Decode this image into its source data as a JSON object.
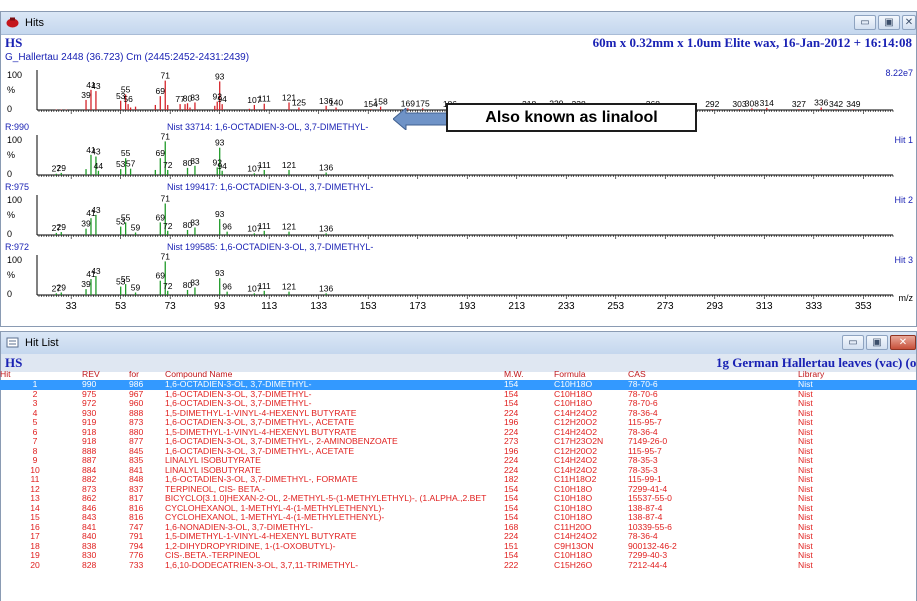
{
  "hits_window": {
    "title": "Hits",
    "header_left": "HS",
    "header_right": "60m x 0.32mm x 1.0um Elite wax,  16-Jan-2012 + 16:14:08",
    "sample_label": "G_Hallertau 2448 (36.723) Cm (2445:2452-2431:2439)",
    "intensity": "8.22e7",
    "x_axis_unit": "m/z",
    "x_ticks": [
      "33",
      "53",
      "73",
      "93",
      "113",
      "133",
      "153",
      "173",
      "193",
      "213",
      "233",
      "253",
      "273",
      "293",
      "313",
      "333",
      "353"
    ],
    "panels": [
      {
        "left_label": "",
        "match": "",
        "hit_label": "",
        "color": "#d4242b",
        "peaks": [
          [
            27,
            1
          ],
          [
            29,
            1
          ],
          [
            31,
            1
          ],
          [
            39,
            24
          ],
          [
            41,
            48
          ],
          [
            43,
            45
          ],
          [
            53,
            22
          ],
          [
            55,
            37
          ],
          [
            56,
            14
          ],
          [
            57,
            6
          ],
          [
            59,
            8
          ],
          [
            67,
            12
          ],
          [
            69,
            33
          ],
          [
            71,
            70
          ],
          [
            72,
            12
          ],
          [
            77,
            14
          ],
          [
            79,
            14
          ],
          [
            80,
            16
          ],
          [
            81,
            6
          ],
          [
            83,
            18
          ],
          [
            91,
            10
          ],
          [
            92,
            20
          ],
          [
            93,
            68
          ],
          [
            94,
            14
          ],
          [
            105,
            3
          ],
          [
            107,
            12
          ],
          [
            111,
            15
          ],
          [
            121,
            18
          ],
          [
            125,
            6
          ],
          [
            136,
            10
          ],
          [
            140,
            6
          ],
          [
            154,
            2
          ],
          [
            158,
            8
          ],
          [
            169,
            4
          ],
          [
            175,
            4
          ],
          [
            186,
            2
          ],
          [
            218,
            2
          ],
          [
            229,
            3
          ],
          [
            238,
            2
          ],
          [
            268,
            2
          ],
          [
            292,
            2
          ],
          [
            303,
            2
          ],
          [
            308,
            4
          ],
          [
            314,
            5
          ],
          [
            327,
            2
          ],
          [
            336,
            6
          ],
          [
            342,
            2
          ],
          [
            349,
            2
          ]
        ],
        "labels": [
          [
            "39",
            "39"
          ],
          [
            "41",
            "41"
          ],
          [
            "43",
            "43"
          ],
          [
            "53",
            "53"
          ],
          [
            "55",
            "55"
          ],
          [
            "56",
            "56"
          ],
          [
            "69",
            "69"
          ],
          [
            "71",
            "71"
          ],
          [
            "77",
            "77"
          ],
          [
            "80",
            "80"
          ],
          [
            "83",
            "83"
          ],
          [
            "92",
            "92"
          ],
          [
            "93",
            "93"
          ],
          [
            "94",
            "94"
          ],
          [
            "107",
            "107"
          ],
          [
            "111",
            "111"
          ],
          [
            "121",
            "121"
          ],
          [
            "125",
            "125"
          ],
          [
            "136",
            "136"
          ],
          [
            "140",
            "140"
          ],
          [
            "154",
            "154"
          ],
          [
            "158",
            "158"
          ],
          [
            "169",
            "169"
          ],
          [
            "175",
            "175"
          ],
          [
            "186",
            "186"
          ],
          [
            "218",
            "218"
          ],
          [
            "229",
            "229"
          ],
          [
            "238",
            "238"
          ],
          [
            "268",
            "268"
          ],
          [
            "292",
            "292"
          ],
          [
            "303",
            "303"
          ],
          [
            "308",
            "308"
          ],
          [
            "314",
            "314"
          ],
          [
            "327",
            "327"
          ],
          [
            "336",
            "336"
          ],
          [
            "342",
            "342"
          ],
          [
            "349",
            "349"
          ]
        ]
      },
      {
        "left_label": "R:990",
        "match": "Nist  33714: 1,6-OCTADIEN-3-OL, 3,7-DIMETHYL-",
        "hit_label": "Hit 1",
        "color": "#1f9a28",
        "peaks": [
          [
            27,
            3
          ],
          [
            29,
            5
          ],
          [
            39,
            14
          ],
          [
            41,
            48
          ],
          [
            43,
            44
          ],
          [
            44,
            10
          ],
          [
            53,
            14
          ],
          [
            55,
            40
          ],
          [
            57,
            15
          ],
          [
            67,
            12
          ],
          [
            69,
            40
          ],
          [
            71,
            80
          ],
          [
            72,
            12
          ],
          [
            80,
            17
          ],
          [
            83,
            22
          ],
          [
            92,
            18
          ],
          [
            93,
            65
          ],
          [
            94,
            10
          ],
          [
            107,
            4
          ],
          [
            111,
            12
          ],
          [
            121,
            12
          ],
          [
            136,
            6
          ]
        ],
        "labels": [
          [
            "27",
            "27"
          ],
          [
            "29",
            "29"
          ],
          [
            "41",
            "41"
          ],
          [
            "43",
            "43"
          ],
          [
            "44",
            "44"
          ],
          [
            "53",
            "53"
          ],
          [
            "55",
            "55"
          ],
          [
            "57",
            "57"
          ],
          [
            "69",
            "69"
          ],
          [
            "71",
            "71"
          ],
          [
            "72",
            "72"
          ],
          [
            "80",
            "80"
          ],
          [
            "83",
            "83"
          ],
          [
            "92",
            "92"
          ],
          [
            "93",
            "93"
          ],
          [
            "94",
            "94"
          ],
          [
            "107",
            "107"
          ],
          [
            "111",
            "111"
          ],
          [
            "121",
            "121"
          ],
          [
            "136",
            "136"
          ]
        ]
      },
      {
        "left_label": "R:975",
        "match": "Nist  199417: 1,6-OCTADIEN-3-OL, 3,7-DIMETHYL-",
        "hit_label": "Hit 2",
        "color": "#1f9a28",
        "peaks": [
          [
            27,
            5
          ],
          [
            29,
            7
          ],
          [
            39,
            15
          ],
          [
            41,
            40
          ],
          [
            43,
            48
          ],
          [
            53,
            20
          ],
          [
            55,
            30
          ],
          [
            59,
            6
          ],
          [
            69,
            30
          ],
          [
            71,
            75
          ],
          [
            72,
            10
          ],
          [
            80,
            12
          ],
          [
            83,
            18
          ],
          [
            93,
            38
          ],
          [
            96,
            8
          ],
          [
            107,
            4
          ],
          [
            111,
            10
          ],
          [
            121,
            8
          ],
          [
            136,
            4
          ]
        ],
        "labels": [
          [
            "27",
            "27"
          ],
          [
            "29",
            "29"
          ],
          [
            "39",
            "39"
          ],
          [
            "41",
            "41"
          ],
          [
            "43",
            "43"
          ],
          [
            "53",
            "53"
          ],
          [
            "55",
            "55"
          ],
          [
            "59",
            "59"
          ],
          [
            "69",
            "69"
          ],
          [
            "71",
            "71"
          ],
          [
            "72",
            "72"
          ],
          [
            "80",
            "80"
          ],
          [
            "83",
            "83"
          ],
          [
            "93",
            "93"
          ],
          [
            "96",
            "96"
          ],
          [
            "107",
            "107"
          ],
          [
            "111",
            "111"
          ],
          [
            "121",
            "121"
          ],
          [
            "136",
            "136"
          ]
        ]
      },
      {
        "left_label": "R:972",
        "match": "Nist  199585: 1,6-OCTADIEN-3-OL, 3,7-DIMETHYL-",
        "hit_label": "Hit 3",
        "color": "#1f9a28",
        "peaks": [
          [
            27,
            4
          ],
          [
            29,
            6
          ],
          [
            39,
            14
          ],
          [
            41,
            38
          ],
          [
            43,
            45
          ],
          [
            53,
            20
          ],
          [
            55,
            26
          ],
          [
            59,
            6
          ],
          [
            69,
            34
          ],
          [
            71,
            80
          ],
          [
            72,
            10
          ],
          [
            80,
            12
          ],
          [
            83,
            18
          ],
          [
            93,
            40
          ],
          [
            96,
            8
          ],
          [
            107,
            4
          ],
          [
            111,
            10
          ],
          [
            121,
            8
          ],
          [
            136,
            4
          ]
        ],
        "labels": [
          [
            "27",
            "27"
          ],
          [
            "29",
            "29"
          ],
          [
            "39",
            "39"
          ],
          [
            "41",
            "41"
          ],
          [
            "43",
            "43"
          ],
          [
            "53",
            "53"
          ],
          [
            "55",
            "55"
          ],
          [
            "59",
            "59"
          ],
          [
            "69",
            "69"
          ],
          [
            "71",
            "71"
          ],
          [
            "72",
            "72"
          ],
          [
            "80",
            "80"
          ],
          [
            "83",
            "83"
          ],
          [
            "93",
            "93"
          ],
          [
            "96",
            "96"
          ],
          [
            "107",
            "107"
          ],
          [
            "111",
            "111"
          ],
          [
            "121",
            "121"
          ],
          [
            "136",
            "136"
          ]
        ]
      }
    ],
    "axis": {
      "y_ticks": [
        "100",
        "%",
        "0"
      ],
      "mz_min": 20,
      "mz_max": 365
    }
  },
  "callout": {
    "text": "Also known as linalool"
  },
  "hitlist_window": {
    "title": "Hit List",
    "header_left": "HS",
    "header_right": "1g German Hallertau leaves (vac) (ol",
    "columns": [
      "Hit",
      "REV",
      "for",
      "Compound Name",
      "M.W.",
      "Formula",
      "CAS",
      "Library"
    ],
    "rows": [
      [
        "1",
        "990",
        "986",
        "1,6-OCTADIEN-3-OL, 3,7-DIMETHYL-",
        "154",
        "C10H18O",
        "78-70-6",
        "Nist"
      ],
      [
        "2",
        "975",
        "967",
        "1,6-OCTADIEN-3-OL, 3,7-DIMETHYL-",
        "154",
        "C10H18O",
        "78-70-6",
        "Nist"
      ],
      [
        "3",
        "972",
        "960",
        "1,6-OCTADIEN-3-OL, 3,7-DIMETHYL-",
        "154",
        "C10H18O",
        "78-70-6",
        "Nist"
      ],
      [
        "4",
        "930",
        "888",
        "1,5-DIMETHYL-1-VINYL-4-HEXENYL BUTYRATE",
        "224",
        "C14H24O2",
        "78-36-4",
        "Nist"
      ],
      [
        "5",
        "919",
        "873",
        "1,6-OCTADIEN-3-OL, 3,7-DIMETHYL-, ACETATE",
        "196",
        "C12H20O2",
        "115-95-7",
        "Nist"
      ],
      [
        "6",
        "918",
        "880",
        "1,5-DIMETHYL-1-VINYL-4-HEXENYL BUTYRATE",
        "224",
        "C14H24O2",
        "78-36-4",
        "Nist"
      ],
      [
        "7",
        "918",
        "877",
        "1,6-OCTADIEN-3-OL, 3,7-DIMETHYL-, 2-AMINOBENZOATE",
        "273",
        "C17H23O2N",
        "7149-26-0",
        "Nist"
      ],
      [
        "8",
        "888",
        "845",
        "1,6-OCTADIEN-3-OL, 3,7-DIMETHYL-, ACETATE",
        "196",
        "C12H20O2",
        "115-95-7",
        "Nist"
      ],
      [
        "9",
        "887",
        "835",
        "LINALYL ISOBUTYRATE",
        "224",
        "C14H24O2",
        "78-35-3",
        "Nist"
      ],
      [
        "10",
        "884",
        "841",
        "LINALYL ISOBUTYRATE",
        "224",
        "C14H24O2",
        "78-35-3",
        "Nist"
      ],
      [
        "11",
        "882",
        "848",
        "1,6-OCTADIEN-3-OL, 3,7-DIMETHYL-, FORMATE",
        "182",
        "C11H18O2",
        "115-99-1",
        "Nist"
      ],
      [
        "12",
        "873",
        "837",
        "TERPINEOL, CIS- BETA.-",
        "154",
        "C10H18O",
        "7299-41-4",
        "Nist"
      ],
      [
        "13",
        "862",
        "817",
        "BICYCLO[3.1.0]HEXAN-2-OL, 2-METHYL-5-(1-METHYLETHYL)-, (1.ALPHA.,2.BET",
        "154",
        "C10H18O",
        "15537-55-0",
        "Nist"
      ],
      [
        "14",
        "846",
        "816",
        "CYCLOHEXANOL, 1-METHYL-4-(1-METHYLETHENYL)-",
        "154",
        "C10H18O",
        "138-87-4",
        "Nist"
      ],
      [
        "15",
        "843",
        "816",
        "CYCLOHEXANOL, 1-METHYL-4-(1-METHYLETHENYL)-",
        "154",
        "C10H18O",
        "138-87-4",
        "Nist"
      ],
      [
        "16",
        "841",
        "747",
        "1,6-NONADIEN-3-OL, 3,7-DIMETHYL-",
        "168",
        "C11H20O",
        "10339-55-6",
        "Nist"
      ],
      [
        "17",
        "840",
        "791",
        "1,5-DIMETHYL-1-VINYL-4-HEXENYL BUTYRATE",
        "224",
        "C14H24O2",
        "78-36-4",
        "Nist"
      ],
      [
        "18",
        "838",
        "794",
        "1,2-DIHYDROPYRIDINE, 1-(1-OXOBUTYL)-",
        "151",
        "C9H13ON",
        "900132-46-2",
        "Nist"
      ],
      [
        "19",
        "830",
        "776",
        "CIS-.BETA.-TERPINEOL",
        "154",
        "C10H18O",
        "7299-40-3",
        "Nist"
      ],
      [
        "20",
        "828",
        "733",
        "1,6,10-DODECATRIEN-3-OL, 3,7,11-TRIMETHYL-",
        "222",
        "C15H26O",
        "7212-44-4",
        "Nist"
      ]
    ]
  }
}
